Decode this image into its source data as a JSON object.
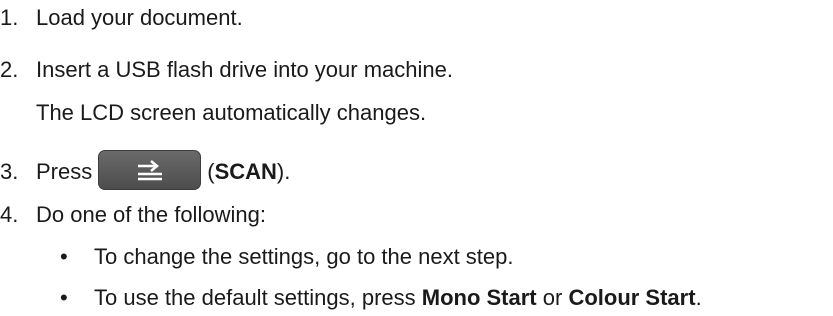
{
  "steps": [
    {
      "num": "1.",
      "text": "Load your document."
    },
    {
      "num": "2.",
      "text": "Insert a USB flash drive into your machine.",
      "note": "The LCD screen automatically changes."
    },
    {
      "num": "3.",
      "pre": "Press",
      "open": "(",
      "bold": "SCAN",
      "close": ").",
      "button_icon": "scan-icon"
    },
    {
      "num": "4.",
      "text": "Do one of the following:"
    }
  ],
  "bullets": [
    {
      "marker": "•",
      "text": "To change the settings, go to the next step."
    },
    {
      "marker": "•",
      "pre": "To use the default settings, press ",
      "bold1": "Mono Start",
      "mid": " or ",
      "bold2": "Colour Start",
      "post": "."
    }
  ],
  "colors": {
    "text": "#1a1a1a",
    "button": "#5a5a5a",
    "icon": "#ffffff"
  }
}
